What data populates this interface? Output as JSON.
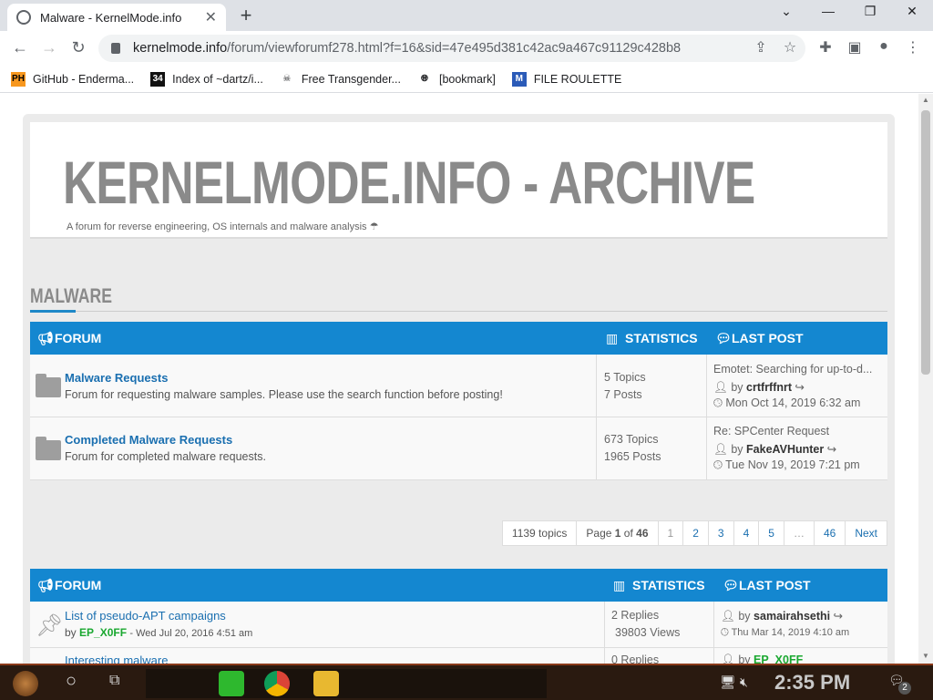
{
  "tab": {
    "title": "Malware - KernelMode.info",
    "close": "✕"
  },
  "window": {
    "minimize": "⌄",
    "min": "—",
    "restore": "❐",
    "close": "✕"
  },
  "toolbar": {
    "url_host": "kernelmode.info",
    "url_path": "/forum/viewforumf278.html?f=16&sid=47e495d381c42ac9a467c91129c428b8"
  },
  "bookmarks": [
    {
      "label": "GitHub - Enderma...",
      "icon": "PH"
    },
    {
      "label": "Index of ~dartz/i...",
      "icon": "34"
    },
    {
      "label": "Free Transgender...",
      "icon": "skull"
    },
    {
      "label": "[bookmark]",
      "icon": "globe"
    },
    {
      "label": "FILE ROULETTE",
      "icon": "M"
    }
  ],
  "site": {
    "title": "KERNELMODE.INFO - ARCHIVE",
    "description": "A forum for reverse engineering, OS internals and malware analysis ☂"
  },
  "forum_name": "MALWARE",
  "table1": {
    "headers": {
      "forum": "FORUM",
      "statistics": "STATISTICS",
      "last_post": "LAST POST"
    },
    "rows": [
      {
        "title": "Malware Requests",
        "desc": "Forum for requesting malware samples. Please use the search function before posting!",
        "topics": "5 Topics",
        "posts": "7 Posts",
        "lp_title": "Emotet: Searching for up-to-d...",
        "lp_by": "by",
        "lp_user": "crtfrffnrt",
        "lp_date": "Mon Oct 14, 2019 6:32 am"
      },
      {
        "title": "Completed Malware Requests",
        "desc": "Forum for completed malware requests.",
        "topics": "673 Topics",
        "posts": "1965 Posts",
        "lp_title": "Re: SPCenter Request",
        "lp_by": "by",
        "lp_user": "FakeAVHunter",
        "lp_date": "Tue Nov 19, 2019 7:21 pm"
      }
    ]
  },
  "pagination": {
    "topics": "1139 topics",
    "page_info_pre": "Page ",
    "page_current": "1",
    "page_info_mid": " of ",
    "page_total": "46",
    "pages": [
      "1",
      "2",
      "3",
      "4",
      "5",
      "…",
      "46"
    ],
    "next": "Next"
  },
  "table2": {
    "headers": {
      "forum": "FORUM",
      "statistics": "STATISTICS",
      "last_post": "LAST POST"
    },
    "rows": [
      {
        "title": "List of pseudo-APT campaigns",
        "by": "by",
        "author": "EP_X0FF",
        "date": "- Wed Jul 20, 2016 4:51 am",
        "replies": "2 Replies",
        "views": "39803 Views",
        "lp_by": "by",
        "lp_user": "samairahsethi",
        "lp_date": "Thu Mar 14, 2019 4:10 am"
      },
      {
        "title": "Interesting malware",
        "replies": "0 Replies",
        "lp_by": "by",
        "lp_user": "EP_X0FF"
      }
    ]
  },
  "taskbar": {
    "time": "2:35 PM",
    "notif": "2"
  }
}
